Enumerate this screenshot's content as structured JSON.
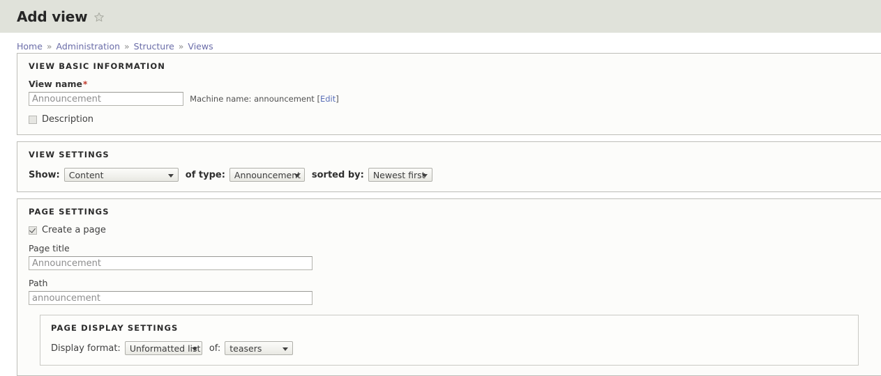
{
  "header": {
    "title": "Add view",
    "star_icon": "star-outline-icon"
  },
  "breadcrumb": {
    "separator": "»",
    "items": [
      {
        "label": "Home"
      },
      {
        "label": "Administration"
      },
      {
        "label": "Structure"
      },
      {
        "label": "Views"
      }
    ]
  },
  "basic_information": {
    "legend": "VIEW BASIC INFORMATION",
    "view_name": {
      "label": "View name",
      "required_marker": "*",
      "value": "Announcement",
      "placeholder": "Announcement"
    },
    "machine_name": {
      "prefix": "Machine name: announcement [",
      "edit_label": "Edit",
      "suffix": "]"
    },
    "description": {
      "label": "Description",
      "checked": false
    }
  },
  "view_settings": {
    "legend": "VIEW SETTINGS",
    "show_label": "Show:",
    "show_value": "Content",
    "of_type_label": "of type:",
    "of_type_value": "Announcement",
    "sorted_by_label": "sorted by:",
    "sorted_by_value": "Newest first"
  },
  "page_settings": {
    "legend": "PAGE SETTINGS",
    "create_page": {
      "label": "Create a page",
      "checked": true
    },
    "page_title": {
      "label": "Page title",
      "value": "Announcement",
      "placeholder": "Announcement"
    },
    "path": {
      "label": "Path",
      "value": "announcement",
      "placeholder": "announcement"
    },
    "display_settings": {
      "legend": "PAGE DISPLAY SETTINGS",
      "display_format_label": "Display format:",
      "display_format_value": "Unformatted list",
      "of_label": "of:",
      "of_value": "teasers"
    }
  },
  "colors": {
    "header_bg": "#e0e2da",
    "fieldset_bg": "#fcfcfa",
    "border": "#bdbdb8",
    "link": "#6a6ca8",
    "required": "#c0392b"
  }
}
